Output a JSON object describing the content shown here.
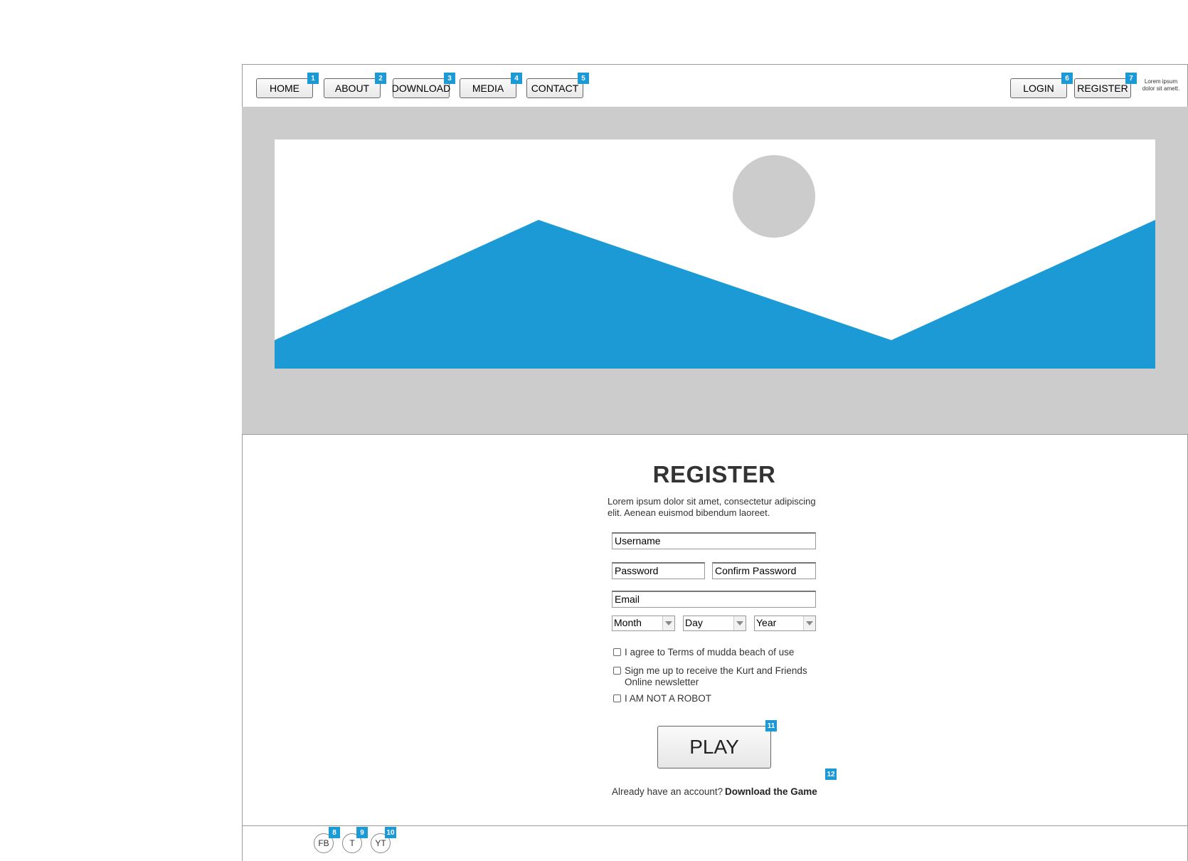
{
  "nav": {
    "home": "HOME",
    "about": "ABOUT",
    "download": "DOWNLOAD",
    "media": "MEDIA",
    "contact": "CONTACT",
    "login": "LOGIN",
    "register": "REGISTER",
    "note": "Lorem ipsum dolor sit amett."
  },
  "hero": {
    "image_icon": "landscape-placeholder-icon",
    "accent_color": "#1b9ad6",
    "background_color": "#cccccc"
  },
  "form": {
    "title": "REGISTER",
    "description": "Lorem ipsum dolor sit amet, consectetur adipiscing elit. Aenean euismod bibendum laoreet.",
    "username": "Username",
    "password": "Password",
    "confirm_password": "Confirm Password",
    "email": "Email",
    "month": "Month",
    "day": "Day",
    "year": "Year",
    "check_terms": "I agree to Terms of mudda beach of use",
    "check_newsletter": "Sign me up to receive the Kurt and Friends Online newsletter",
    "check_robot": "I AM NOT A ROBOT",
    "play": "PLAY",
    "already": "Already have an account?",
    "download_link": "Download the Game"
  },
  "footer": {
    "fb": "FB",
    "t": "T",
    "yt": "YT"
  },
  "badges": [
    "1",
    "2",
    "3",
    "4",
    "5",
    "6",
    "7",
    "8",
    "9",
    "10",
    "11",
    "12"
  ]
}
